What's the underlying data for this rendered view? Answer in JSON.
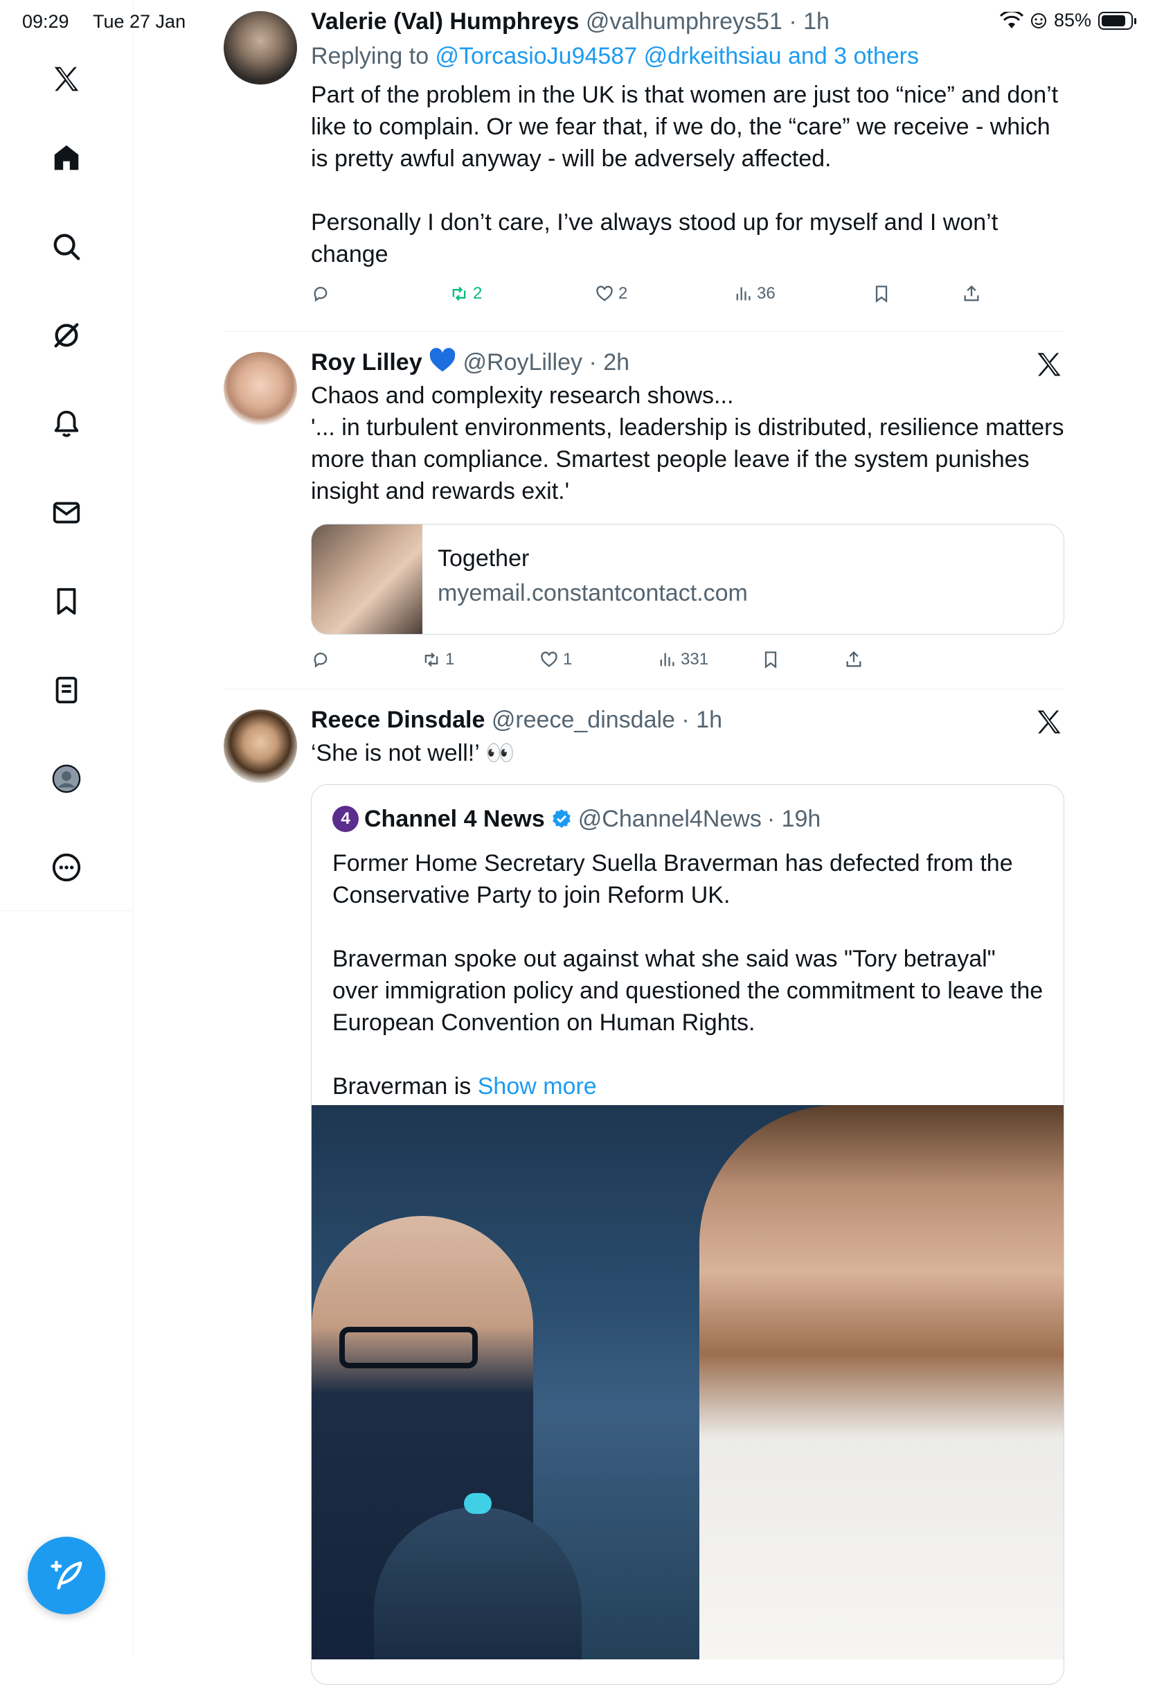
{
  "status_bar": {
    "time": "09:29",
    "date": "Tue 27 Jan",
    "battery": "85%"
  },
  "sidebar": {
    "items": [
      {
        "name": "x-logo",
        "icon": "x-logo-icon"
      },
      {
        "name": "home",
        "icon": "home-icon"
      },
      {
        "name": "search",
        "icon": "search-icon"
      },
      {
        "name": "grok",
        "icon": "grok-icon"
      },
      {
        "name": "notifications",
        "icon": "bell-icon"
      },
      {
        "name": "messages",
        "icon": "mail-icon"
      },
      {
        "name": "bookmarks",
        "icon": "bookmark-icon"
      },
      {
        "name": "lists",
        "icon": "list-icon"
      },
      {
        "name": "profile",
        "icon": "profile-icon"
      },
      {
        "name": "more",
        "icon": "more-icon"
      }
    ],
    "compose": "compose-icon"
  },
  "tweets": [
    {
      "name": "Valerie (Val) Humphreys",
      "handle": "@valhumphreys51",
      "time": "· 1h",
      "replying_prefix": "Replying to ",
      "replying_links": "@TorcasioJu94587 @drkeithsiau and 3 others",
      "text": [
        "Part of the problem in the UK is that women are just too “nice” and don’t like to complain. Or we fear  that, if we do, the “care” we receive - which is pretty awful anyway - will be adversely affected.",
        "",
        "Personally I don’t care, I’ve always stood up for myself and I won’t change"
      ],
      "retweets": "2",
      "likes": "2",
      "views": "36"
    },
    {
      "name": "Roy Lilley",
      "handle": "@RoyLilley",
      "time": "· 2h",
      "text": [
        "Chaos and complexity research shows...",
        "'... in turbulent environments, leadership is distributed, resilience matters more than compliance. Smartest people leave if the system punishes insight and rewards exit.'"
      ],
      "card": {
        "title": "Together",
        "domain": "myemail.constantcontact.com"
      },
      "retweets": "1",
      "likes": "1",
      "views": "331"
    },
    {
      "name": "Reece Dinsdale",
      "handle": "@reece_dinsdale",
      "time": "· 1h",
      "text": "‘She is not well!’ 👀",
      "quote": {
        "logo": "4",
        "name": "Channel 4 News",
        "handle": "@Channel4News",
        "time": "· 19h",
        "text": [
          "Former Home Secretary Suella Braverman has defected from the Conservative Party to join Reform UK.",
          "",
          "Braverman spoke out against what she said was \"Tory betrayal\" over immigration policy and questioned the commitment to leave the European Convention on Human Rights.",
          ""
        ],
        "truncated_text": "Braverman is ",
        "show_more": "Show more"
      }
    }
  ],
  "colors": {
    "accent": "#1d9bf0",
    "retweet_active": "#00ba7c",
    "secondary_text": "#536471"
  }
}
